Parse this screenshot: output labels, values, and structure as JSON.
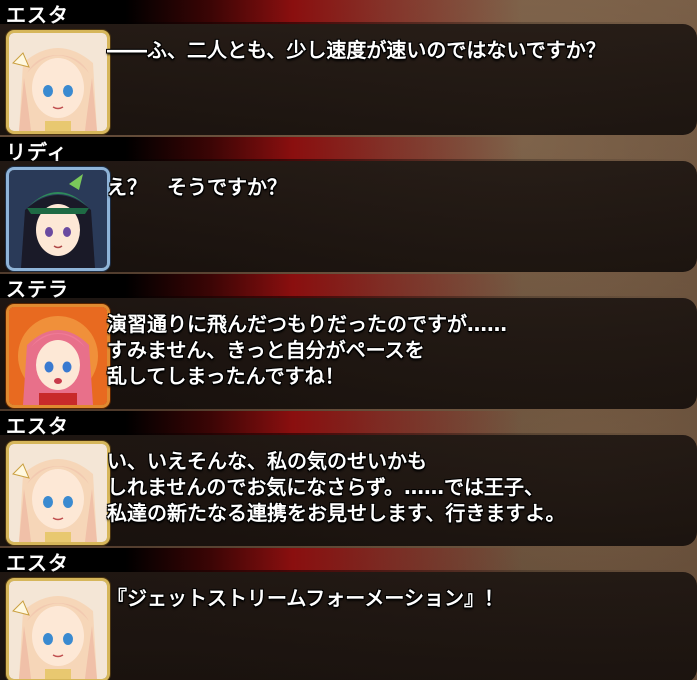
{
  "entries": [
    {
      "speaker": "エスタ",
      "lines": [
        "――ふ、二人とも、少し速度が速いのではないですか？"
      ],
      "portrait": "esta-portrait"
    },
    {
      "speaker": "リディ",
      "lines": [
        "え？　そうですか？"
      ],
      "portrait": "lidi-portrait"
    },
    {
      "speaker": "ステラ",
      "lines": [
        "演習通りに飛んだつもりだったのですが……",
        "すみません、きっと自分がペースを",
        "乱してしまったんですね！"
      ],
      "portrait": "stella-portrait"
    },
    {
      "speaker": "エスタ",
      "lines": [
        "い、いえそんな、私の気のせいかも",
        "しれませんのでお気になさらず。……では王子、",
        "私達の新たなる連携をお見せします、行きますよ。"
      ],
      "portrait": "esta-portrait"
    },
    {
      "speaker": "エスタ",
      "lines": [
        "『ジェットストリームフォーメーション』！"
      ],
      "portrait": "esta-portrait"
    }
  ],
  "colors": {
    "name_strip_red": "#8a0f0f",
    "panel_dark": "#140e0c",
    "gold_frame": "#d6b65a"
  }
}
